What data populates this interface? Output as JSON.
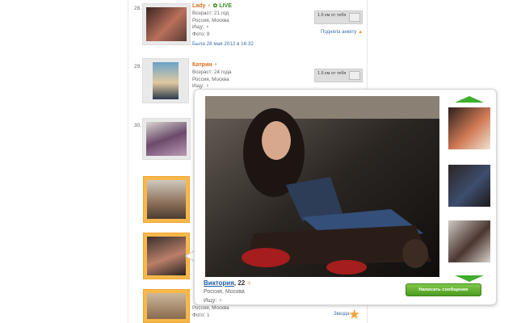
{
  "profiles": [
    {
      "number": "28.",
      "name": "Lady",
      "live": "LIVE",
      "age": "Возраст: 21 год",
      "location": "Россия, Москва",
      "seeking": "Ищу:",
      "photos": "Фото: 8",
      "last_seen": "Была 28 мая 2012 в 16:32",
      "distance": "1.6 км от тебя",
      "action": "Подняла анкету"
    },
    {
      "number": "29.",
      "name": "Катрин",
      "age": "Возраст: 24 года",
      "location": "Россия, Москва",
      "seeking": "Ищу:",
      "distance": "1.6 км от тебя"
    },
    {
      "number": "30."
    },
    {
      "location": "Россия, Москва",
      "photos": "Фото: 1",
      "action": "Звезда"
    }
  ],
  "popup": {
    "name": "Виктория",
    "age": ", 22",
    "location": "Россия, Москва",
    "seeking": "Ищу:",
    "send_button": "Написать сообщение"
  },
  "icons": {
    "female": "female-icon",
    "live": "webcam-icon",
    "star": "star-icon",
    "up": "arrow-up-icon",
    "down": "arrow-down-icon"
  },
  "colors": {
    "name": "#e06a1a",
    "link": "#3b6fa8",
    "accent_green": "#3fae2f",
    "gold_frame": "#f7b74a"
  }
}
